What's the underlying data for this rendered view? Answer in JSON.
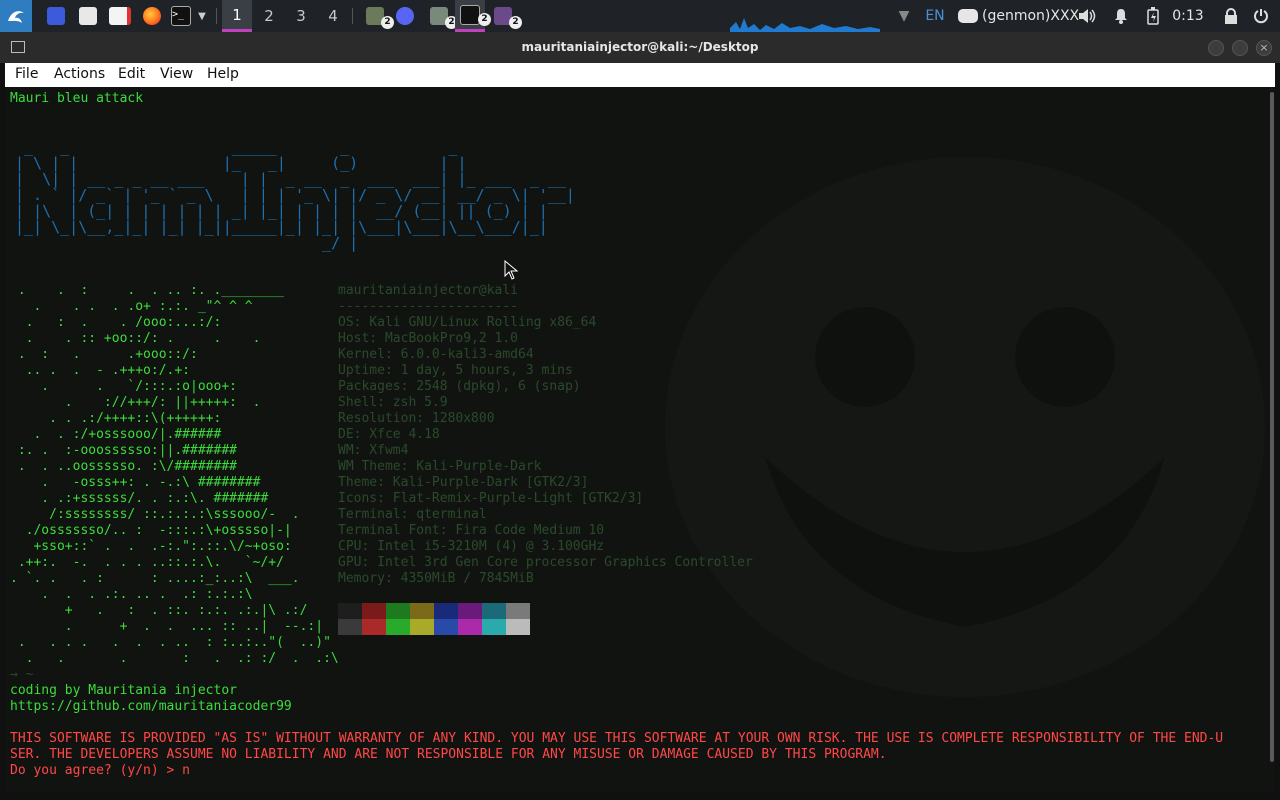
{
  "panel": {
    "workspaces": [
      "1",
      "2",
      "3",
      "4"
    ],
    "language": "EN",
    "genmon": "(genmon)XXX",
    "clock": "0:13",
    "badges": [
      "2",
      "2",
      "2",
      "2"
    ]
  },
  "window": {
    "title": "mauritaniainjector@kali:~/Desktop"
  },
  "menu": {
    "file": "File",
    "actions": "Actions",
    "edit": "Edit",
    "view": "View",
    "help": "Help"
  },
  "terminal": {
    "header": "Mauri bleu attack",
    "banner": [
      " _   _                  _____       _           _            ",
      "| \\ | |                |_   _|     (_)         | |           ",
      "|  \\| | __ _ _ __ ___    | |  _ __  _  ___  ___| |_ ___  _ __ ",
      "| . ` |/ _` | '_ ` _ \\   | | | '_ \\| |/ _ \\/ __| __/ _ \\| '__|",
      "| |\\  | (_| | | | | | | _| |_| | | | |  __/ (__| || (_) | |   ",
      "|_| \\_|\\__,_|_| |_| |_||_____|_| |_| |\\___|\\___|\\__\\___/|_|   ",
      "                                  _/ |                        "
    ],
    "neofetch_art": [
      " .    .  :     .  . .. :. .________",
      "   .    . .  . .o+ :.:. _\"^ ^ ^  ",
      "  .   :  .    . /ooo:...:/:       ",
      "  .    . :: +oo::/: .     .    .  ",
      " .  :   .      .+ooo::/:          ",
      "  .. .  .  - .+++o:/.+:          ",
      "    .      .   `/:::.:o|ooo+:      ",
      "       .    ://+++/: ||+++++:  .   ",
      "     . . .:/++++::\\(++++++:       ",
      "   .  . :/+osssooo/|.######       ",
      " :. .  :-ooossssso:||.#######     ",
      " .  . ..oossssso. :\\/########     ",
      "    .   -osss++: . -.:\\ ########  ",
      "    . .:+ssssss/. . :.:\\. #######  ",
      "     /:ssssssss/ ::.:.:.:\\sssooo/-  .",
      "  ./osssssso/.. :  -:::.:\\+osssso|-|",
      "   +sso+::` .  .  .-:.\":.::.\\/~+oso:",
      " .++:.  -.  . . . ..::.:.\\.   `~/+/",
      ". `. .   . :      : ....:_:..:\\  ___.",
      "    .  .  . .:. .. .  .: :.:.:\\    ",
      "       +   .   :  . ::. :.:. .:.|\\ .:/",
      "       .      +  .  .  ... :: ..|  --.:|",
      " .   . . .   .  .  . ..  : :..:..\"(  ..)\"",
      "  .   .       .       :   .  .: :/  .  .:\\"
    ],
    "info_user": "mauritaniainjector@kali",
    "info_sep": "-----------------------",
    "info_lines": [
      "OS: Kali GNU/Linux Rolling x86_64",
      "Host: MacBookPro9,2 1.0",
      "Kernel: 6.0.0-kali3-amd64",
      "Uptime: 1 day, 5 hours, 3 mins",
      "Packages: 2548 (dpkg), 6 (snap)",
      "Shell: zsh 5.9",
      "Resolution: 1280x800",
      "DE: Xfce 4.18",
      "WM: Xfwm4",
      "WM Theme: Kali-Purple-Dark",
      "Theme: Kali-Purple-Dark [GTK2/3]",
      "Icons: Flat-Remix-Purple-Light [GTK2/3]",
      "Terminal: qterminal",
      "Terminal Font: Fira Code Medium 10",
      "CPU: Intel i5-3210M (4) @ 3.100GHz",
      "GPU: Intel 3rd Gen Core processor Graphics Controller",
      "Memory: 4350MiB / 7845MiB"
    ],
    "palette_top": [
      "#1e1e1e",
      "#7a1a1a",
      "#1e7a1e",
      "#7a6a1a",
      "#1a2a7a",
      "#6a1a7a",
      "#1a6a7a",
      "#7a7a7a"
    ],
    "palette_bottom": [
      "#3a3a3a",
      "#aa2a2a",
      "#2aaa2a",
      "#aaaa2a",
      "#2a4aaa",
      "#aa2aaa",
      "#2aaaaa",
      "#bbbbbb"
    ],
    "prompt_ghost": "→ ~",
    "credit": "coding by Mauritania injector",
    "url": "https://github.com/mauritaniacoder99",
    "warning_1": "THIS SOFTWARE IS PROVIDED \"AS IS\" WITHOUT WARRANTY OF ANY KIND. YOU MAY USE THIS SOFTWARE AT YOUR OWN RISK. THE USE IS COMPLETE RESPONSIBILITY OF THE END-U",
    "warning_2": "SER. THE DEVELOPERS ASSUME NO LIABILITY AND ARE NOT RESPONSIBLE FOR ANY MISUSE OR DAMAGE CAUSED BY THIS PROGRAM.",
    "prompt": "Do you agree? (y/n) > n"
  },
  "icons": {
    "kali": "kali-dragon-icon",
    "apps": [
      "app-menu-icon",
      "files-icon",
      "text-editor-icon",
      "firefox-icon",
      "terminal-icon",
      "chevron-down-icon"
    ],
    "tasks": [
      "tools-icon",
      "discord-icon",
      "folder-icon",
      "terminal-icon",
      "window-icon"
    ],
    "tray": [
      "network-icon",
      "discord-icon",
      "volume-icon",
      "bell-icon",
      "battery-icon",
      "lock-icon",
      "power-icon"
    ]
  }
}
